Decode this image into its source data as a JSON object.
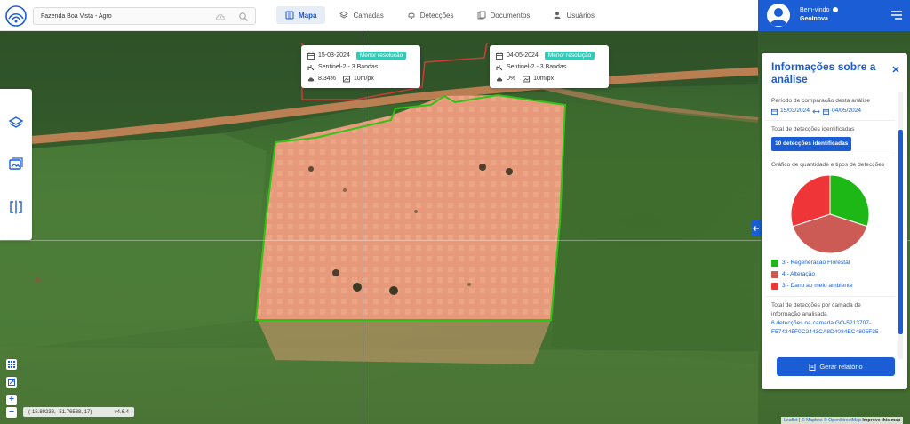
{
  "search": {
    "value": "Fazenda Boa Vista - Agro"
  },
  "nav": [
    {
      "label": "Mapa",
      "icon": "map-icon",
      "active": true
    },
    {
      "label": "Camadas",
      "icon": "layers-icon"
    },
    {
      "label": "Detecções",
      "icon": "bell-icon"
    },
    {
      "label": "Documentos",
      "icon": "document-icon"
    },
    {
      "label": "Usuários",
      "icon": "user-icon"
    }
  ],
  "user": {
    "greeting": "Bem-vindo",
    "name": "GeoInova"
  },
  "compare_left": {
    "date": "15-03-2024",
    "badge": "Menor resolução",
    "sensor": "Sentinel-2 - 3 Bandas",
    "cloud": "8.34%",
    "resolution": "10m/px"
  },
  "compare_right": {
    "date": "04-05-2024",
    "badge": "Menor resolução",
    "sensor": "Sentinel-2 - 3 Bandas",
    "cloud": "0%",
    "resolution": "10m/px"
  },
  "panel": {
    "title": "Informações sobre a análise",
    "period_label": "Período de comparação desta análise",
    "period_start": "15/03/2024",
    "period_end": "04/05/2024",
    "total_label": "Total de detecções identificadas",
    "total_badge": "10 detecções identificadas",
    "chart_label": "Gráfico de quantidade e tipos de detecções",
    "layer_label": "Total de detecções por camada de informação analisada",
    "layer_item": "6 detecções na camada GO-5213707-F574245F0C2443CA8D4084EC4805F35",
    "report_button": "Gerar relatório"
  },
  "chart_data": {
    "type": "pie",
    "categories": [
      "Regeneração Florestal",
      "Alteração",
      "Dano ao meio ambiente"
    ],
    "values": [
      3,
      4,
      3
    ],
    "colors": [
      "#1db816",
      "#cc5b55",
      "#ef3538"
    ],
    "legend": [
      "3 - Regeneração Florestal",
      "4 - Alteração",
      "3 - Dano ao meio ambiente"
    ]
  },
  "map": {
    "coords": "(-15.89238, -51.76538, 17)",
    "version": "v4.6.4",
    "attribution_leaflet": "Leaflet",
    "attribution_mapbox": "© Mapbox",
    "attribution_osm": "© OpenStreetMap",
    "attribution_improve": "Improve this map"
  }
}
